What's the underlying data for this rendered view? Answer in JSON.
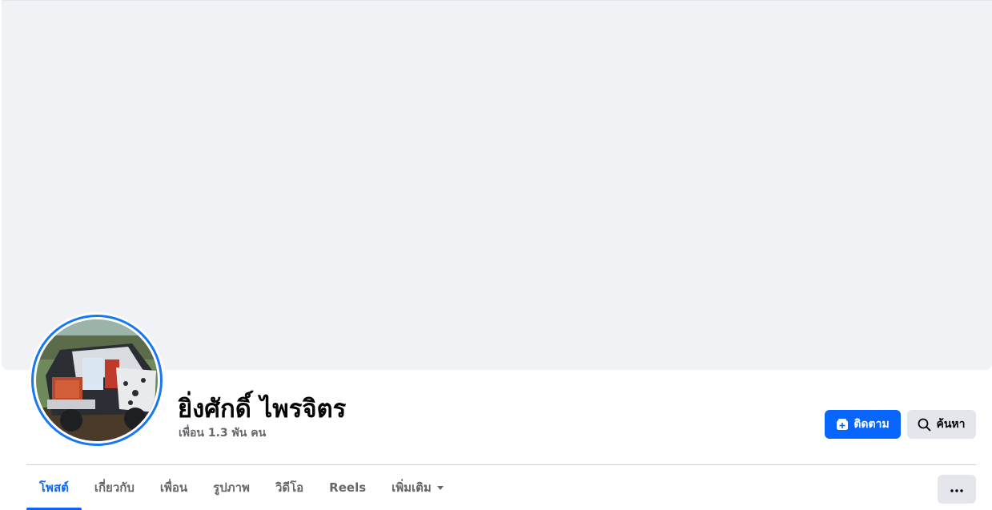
{
  "profile": {
    "name": "ยิ่งศักดิ์ ไพรจิตร",
    "friends_count": "เพื่อน 1.3 พัน คน"
  },
  "actions": {
    "follow_label": "ติดตาม",
    "search_label": "ค้นหา",
    "more_icon": "ellipsis-icon"
  },
  "tabs": [
    {
      "label": "โพสต์",
      "active": true
    },
    {
      "label": "เกี่ยวกับ",
      "active": false
    },
    {
      "label": "เพื่อน",
      "active": false
    },
    {
      "label": "รูปภาพ",
      "active": false
    },
    {
      "label": "วิดีโอ",
      "active": false
    },
    {
      "label": "Reels",
      "active": false
    },
    {
      "label": "เพิ่มเติม",
      "active": false
    }
  ],
  "colors": {
    "accent": "#0866ff",
    "avatar_ring": "#1877f2",
    "cover": "#f0f2f5",
    "secondary_button": "#e4e6eb",
    "muted_text": "#65676b"
  }
}
